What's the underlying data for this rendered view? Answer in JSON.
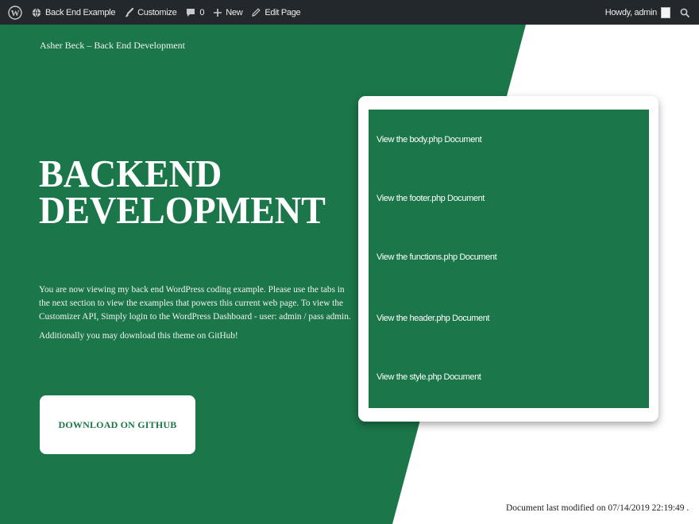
{
  "admin_bar": {
    "site_name": "Back End Example",
    "customize": "Customize",
    "comments_count": "0",
    "new": "New",
    "edit_page": "Edit Page",
    "howdy": "Howdy, admin"
  },
  "site": {
    "title": "Asher Beck – Back End Development"
  },
  "hero": {
    "title_line1": "BACKEND",
    "title_line2": "DEVELOPMENT",
    "intro_paragraph": "You are now viewing my back end WordPress coding example. Please use the tabs in the next section to view the examples that powers this current web page. To view the Customizer API, Simply login to the WordPress Dashboard - user: admin / pass admin.",
    "github_note": "Additionally you may download this theme on GitHub!",
    "button_label": "DOWNLOAD ON GITHUB"
  },
  "documents": [
    {
      "label": "View the body.php Document"
    },
    {
      "label": "View the footer.php Document"
    },
    {
      "label": "View the functions.php Document"
    },
    {
      "label": "View the header.php Document"
    },
    {
      "label": "View the style.php Document"
    }
  ],
  "footer": {
    "modified": "Document last modified on 07/14/2019 22:19:49 ."
  },
  "colors": {
    "brand_green": "#1b7649",
    "admin_bar": "#23282d"
  }
}
